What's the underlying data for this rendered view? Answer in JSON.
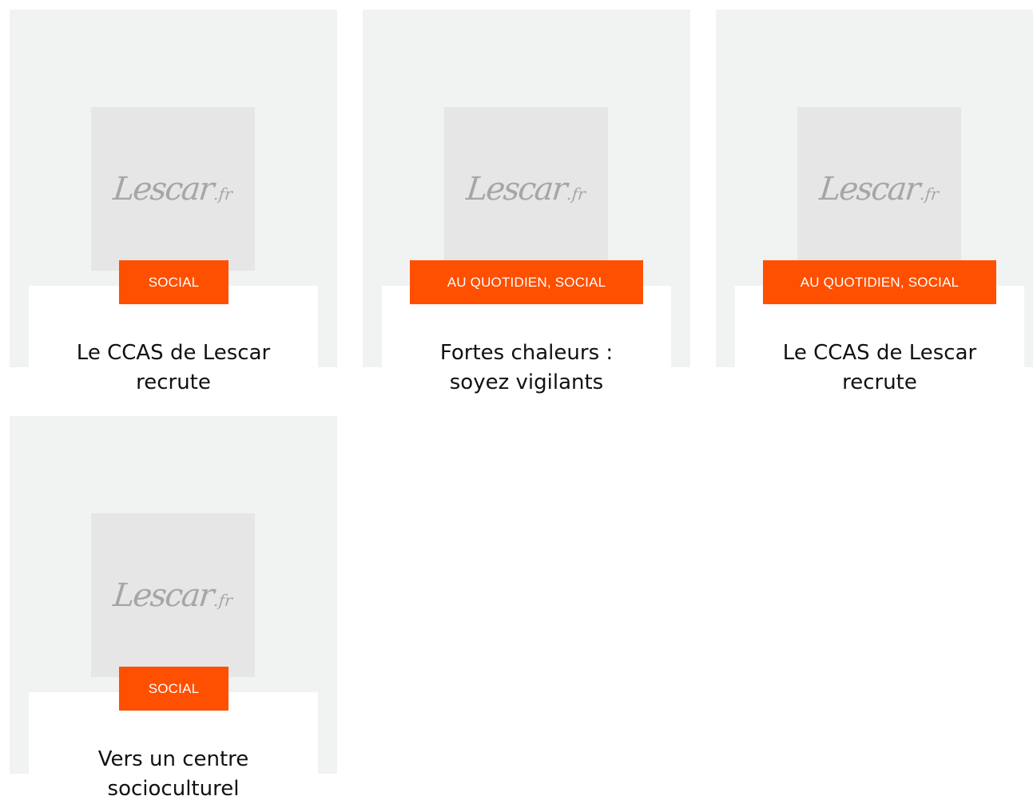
{
  "cards": [
    {
      "logo_main": "Lescar",
      "logo_tld": ".fr",
      "category": "SOCIAL",
      "title_line1": "Le CCAS de Lescar",
      "title_line2": "recrute"
    },
    {
      "logo_main": "Lescar",
      "logo_tld": ".fr",
      "category": "AU QUOTIDIEN, SOCIAL",
      "title_line1": "Fortes chaleurs :",
      "title_line2": "soyez vigilants"
    },
    {
      "logo_main": "Lescar",
      "logo_tld": ".fr",
      "category": "AU QUOTIDIEN, SOCIAL",
      "title_line1": "Le CCAS de Lescar",
      "title_line2": "recrute"
    },
    {
      "logo_main": "Lescar",
      "logo_tld": ".fr",
      "category": "SOCIAL",
      "title_line1": "Vers un centre",
      "title_line2": "socioculturel"
    }
  ],
  "colors": {
    "card_background": "#f1f2f2",
    "thumbnail_background": "#e6e6e6",
    "badge": "#ff4f00",
    "badge_text": "#ffffff",
    "title_text": "#111111"
  }
}
